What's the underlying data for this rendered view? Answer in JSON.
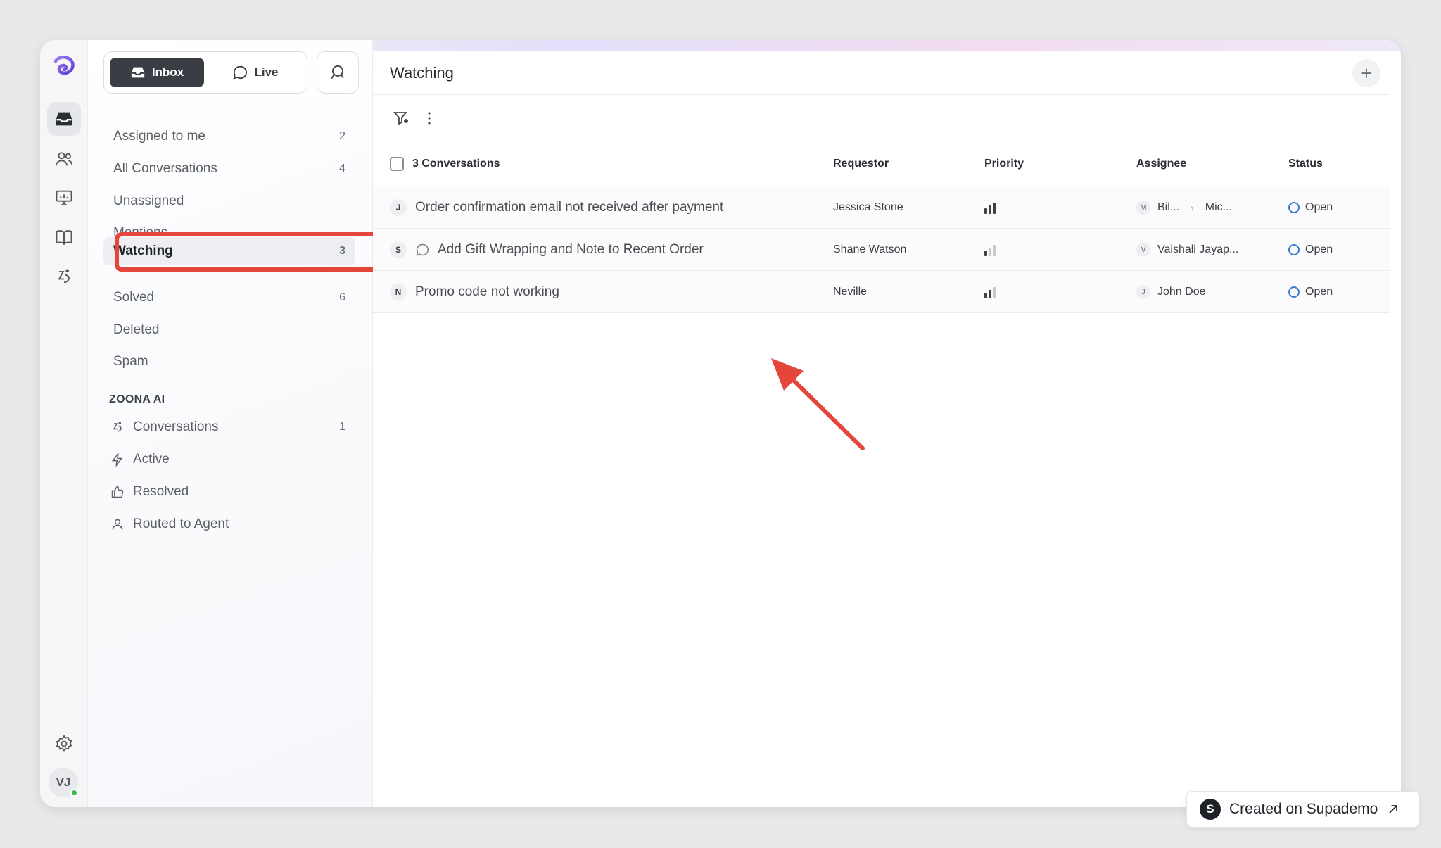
{
  "segmented": {
    "inbox_label": "Inbox",
    "live_label": "Live"
  },
  "nav": [
    {
      "label": "Assigned to me",
      "count": "2"
    },
    {
      "label": "All Conversations",
      "count": "4"
    },
    {
      "label": "Unassigned",
      "count": ""
    },
    {
      "label": "Mentions",
      "count": ""
    },
    {
      "label": "Watching",
      "count": "3"
    },
    {
      "label": "Solved",
      "count": "6"
    },
    {
      "label": "Deleted",
      "count": ""
    },
    {
      "label": "Spam",
      "count": ""
    }
  ],
  "ai_section": {
    "title": "ZOONA AI",
    "items": [
      {
        "label": "Conversations",
        "count": "1",
        "icon": "zoona-icon"
      },
      {
        "label": "Active",
        "count": "",
        "icon": "lightning-icon"
      },
      {
        "label": "Resolved",
        "count": "",
        "icon": "thumbs-up-icon"
      },
      {
        "label": "Routed to Agent",
        "count": "",
        "icon": "agent-icon"
      }
    ]
  },
  "user": {
    "initials": "VJ",
    "online": true
  },
  "main": {
    "title": "Watching"
  },
  "table": {
    "header": {
      "conversations": "3 Conversations",
      "requestor": "Requestor",
      "priority": "Priority",
      "assignee": "Assignee",
      "status": "Status"
    },
    "rows": [
      {
        "initial": "J",
        "title": "Order confirmation email not received after payment",
        "has_chat_icon": false,
        "requestor": "Jessica Stone",
        "priority_level": 3,
        "assignee_initial": "M",
        "assignee": "Bil...",
        "assignee_to": "Mic...",
        "status": "Open"
      },
      {
        "initial": "S",
        "title": "Add Gift Wrapping and Note to Recent Order",
        "has_chat_icon": true,
        "requestor": "Shane Watson",
        "priority_level": 1,
        "assignee_initial": "V",
        "assignee": "Vaishali Jayap...",
        "assignee_to": "",
        "status": "Open"
      },
      {
        "initial": "N",
        "title": "Promo code not working",
        "has_chat_icon": false,
        "requestor": "Neville",
        "priority_level": 2,
        "assignee_initial": "J",
        "assignee": "John Doe",
        "assignee_to": "",
        "status": "Open"
      }
    ]
  },
  "badge": {
    "logo_letter": "S",
    "label": "Created on Supademo"
  },
  "colors": {
    "accent": "#3a3d44",
    "highlight": "#e5463b",
    "status_open": "#3a7bd5",
    "brand": "#7b5ce6"
  }
}
